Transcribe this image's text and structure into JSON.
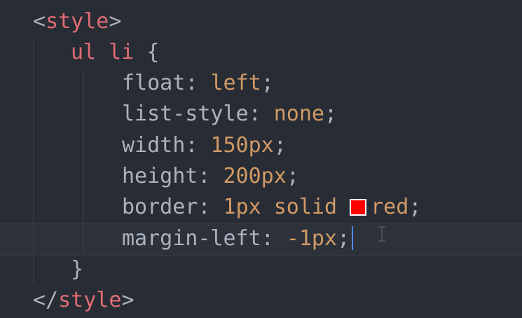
{
  "editor": {
    "colors": {
      "background": "#282c34",
      "tag": "#e06c75",
      "value": "#d19a66",
      "text": "#abb2bf",
      "cursor": "#528bff",
      "current_line": "#2c313a"
    },
    "lines": [
      {
        "open": "<",
        "tag": "style",
        "close": ">"
      },
      {
        "selector": "ul li",
        "brace": " {"
      },
      {
        "prop": "float",
        "sep": ": ",
        "value": "left",
        "end": ";"
      },
      {
        "prop": "list-style",
        "sep": ": ",
        "value": "none",
        "end": ";"
      },
      {
        "prop": "width",
        "sep": ": ",
        "value": "150px",
        "end": ";"
      },
      {
        "prop": "height",
        "sep": ": ",
        "value": "200px",
        "end": ";"
      },
      {
        "prop": "border",
        "sep": ": ",
        "value": "1px solid",
        "swatch_color": "#ff0000",
        "value2": "red",
        "end": ";"
      },
      {
        "prop": "margin-left",
        "sep": ": ",
        "value": "-1px",
        "end": ";"
      },
      {
        "brace": "}"
      },
      {
        "open": "</",
        "tag": "style",
        "close": ">"
      }
    ]
  }
}
